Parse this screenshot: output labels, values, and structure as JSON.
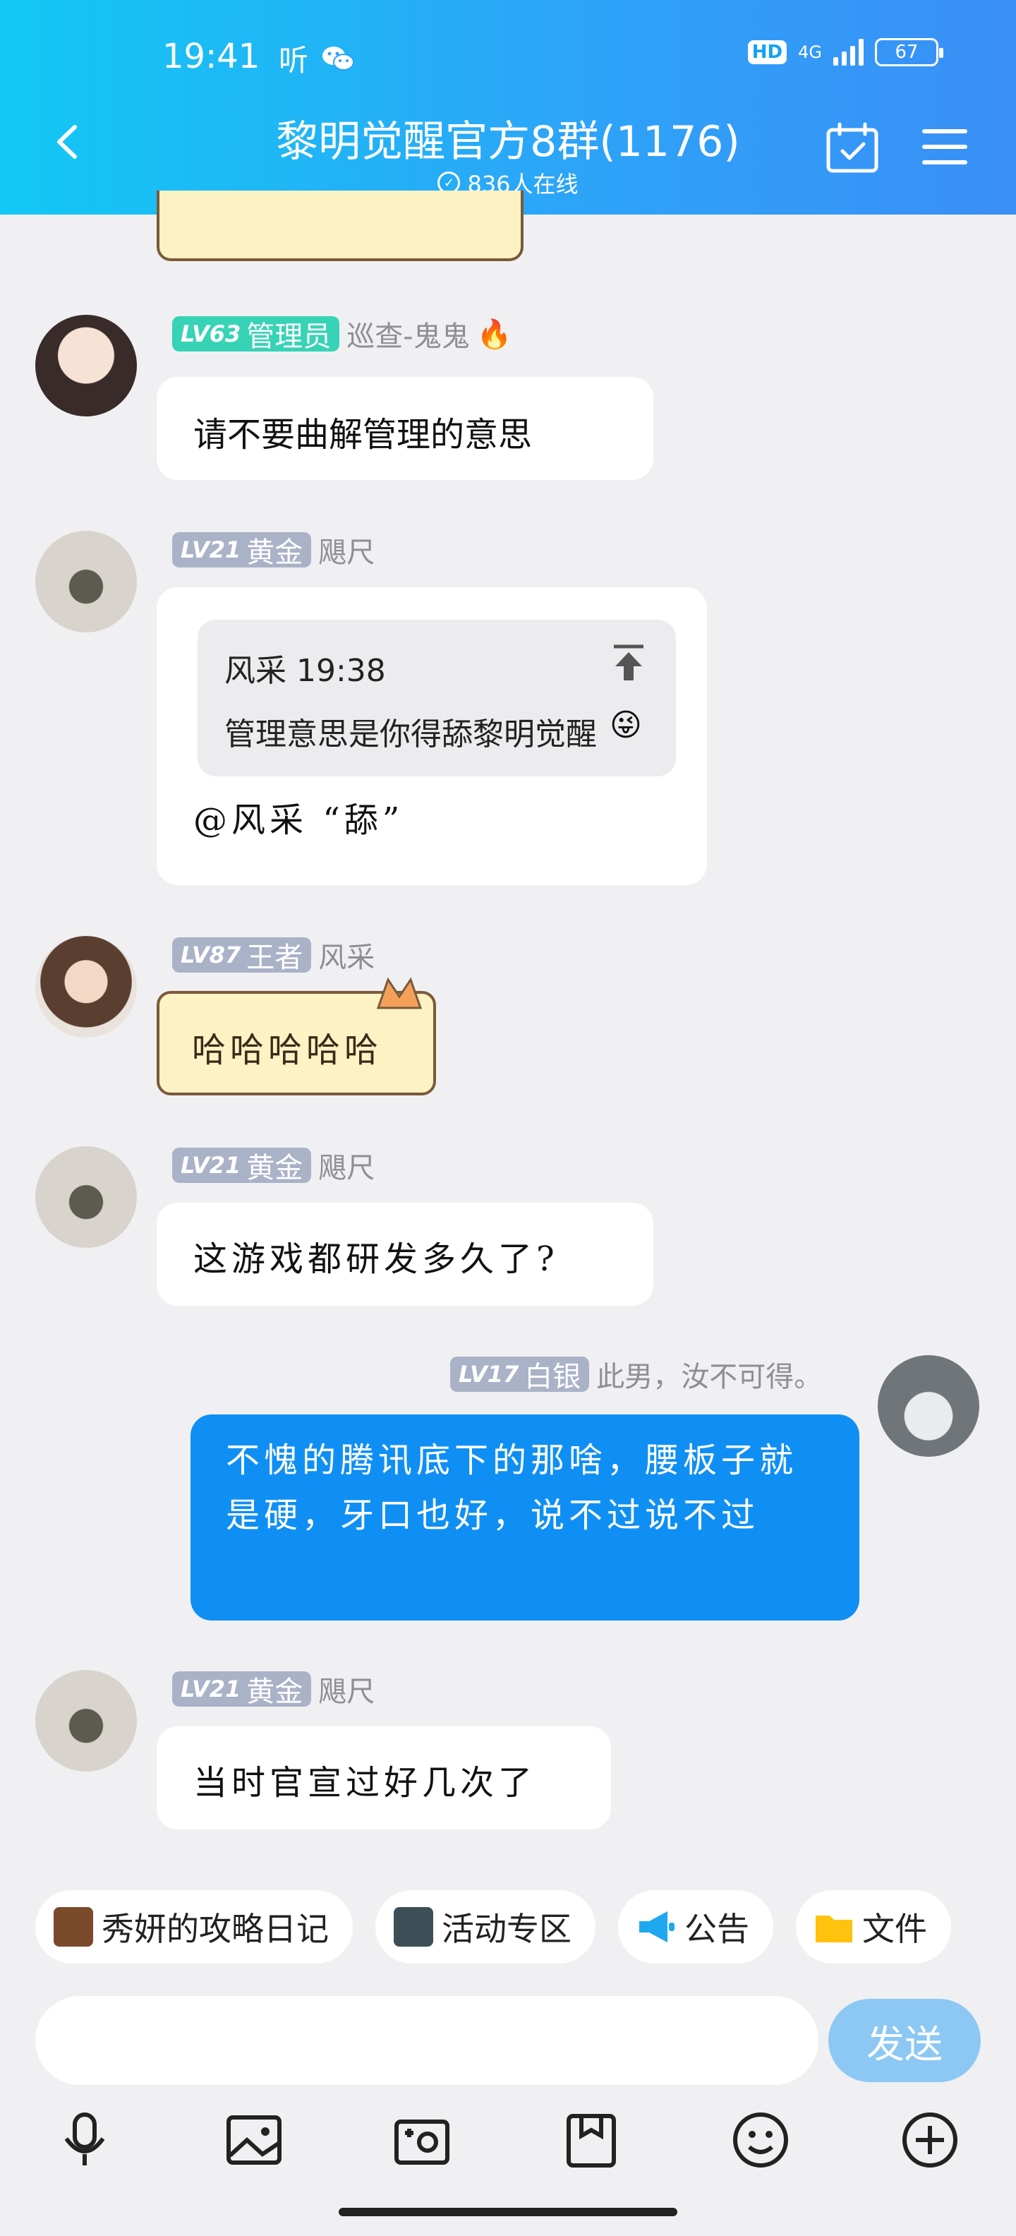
{
  "status_bar": {
    "time": "19:41",
    "left_icons": [
      "听"
    ],
    "network": "4G",
    "battery": "67"
  },
  "header": {
    "title": "黎明觉醒官方8群(1176)",
    "online": "836人在线"
  },
  "messages": [
    {
      "level": "LV63",
      "role": "管理员",
      "name": "巡查-鬼鬼",
      "text": "请不要曲解管理的意思"
    },
    {
      "level": "LV21",
      "role": "黄金",
      "name": "飓尺",
      "quote": {
        "author": "风采 19:38",
        "text": "管理意思是你得舔黎明觉醒"
      },
      "text": "@风采 “舔”"
    },
    {
      "level": "LV87",
      "role": "王者",
      "name": "风采",
      "text": "哈哈哈哈哈"
    },
    {
      "level": "LV21",
      "role": "黄金",
      "name": "飓尺",
      "text": "这游戏都研发多久了?"
    },
    {
      "level": "LV17",
      "role": "白银",
      "name": "此男，汝不可得。",
      "text": "不愧的腾讯底下的那啥，腰板子就是硬，牙口也好，说不过说不过"
    },
    {
      "level": "LV21",
      "role": "黄金",
      "name": "飓尺",
      "text": "当时官宣过好几次了"
    }
  ],
  "quick_bar": [
    {
      "icon": "book-icon",
      "label": "秀妍的攻略日记"
    },
    {
      "icon": "game-icon",
      "label": "活动专区"
    },
    {
      "icon": "megaphone-icon",
      "label": "公告"
    },
    {
      "icon": "folder-icon",
      "label": "文件"
    }
  ],
  "input": {
    "placeholder": "",
    "send_label": "发送"
  },
  "toolbar": [
    "microphone-icon",
    "image-icon",
    "camera-icon",
    "gift-icon",
    "emoji-icon",
    "plus-icon"
  ]
}
